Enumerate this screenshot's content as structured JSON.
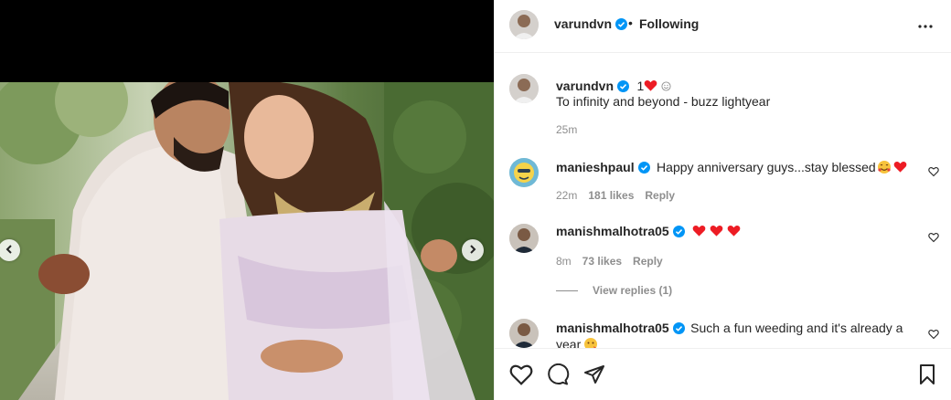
{
  "post": {
    "username": "varundvn",
    "separator": "•",
    "follow_status": "Following",
    "more_icon": "more-horizontal-icon"
  },
  "caption": {
    "username": "varundvn",
    "prefix": "1",
    "text": "To infinity and beyond - buzz lightyear",
    "time": "25m"
  },
  "comments": [
    {
      "username": "manieshpaul",
      "text": "Happy anniversary guys...stay blessed",
      "time": "22m",
      "likes": "181 likes",
      "reply": "Reply"
    },
    {
      "username": "manishmalhotra05",
      "text": "",
      "time": "8m",
      "likes": "73 likes",
      "reply": "Reply",
      "view_replies": "View replies (1)"
    },
    {
      "username": "manishmalhotra05",
      "text": "Such a fun weeding and it's already a",
      "text_line2": "year"
    }
  ],
  "actions": {
    "like_icon": "heart-icon",
    "comment_icon": "comment-icon",
    "share_icon": "share-icon",
    "save_icon": "bookmark-icon"
  },
  "colors": {
    "verified": "#0095f6",
    "heart": "#ed4956",
    "muted": "#8e8e8e"
  }
}
